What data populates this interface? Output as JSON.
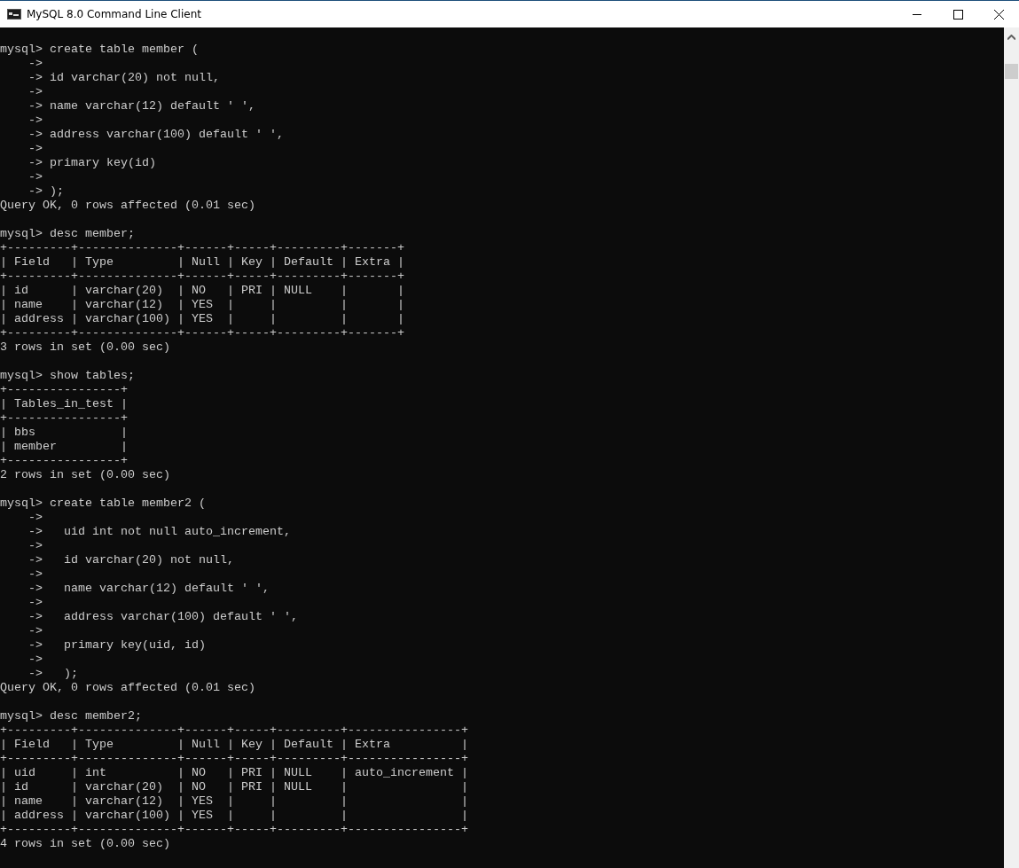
{
  "window": {
    "title": "MySQL 8.0 Command Line Client"
  },
  "console": {
    "blocks": [
      {
        "lines": [
          "mysql> create table member (",
          "    ->",
          "    -> id varchar(20) not null,",
          "    ->",
          "    -> name varchar(12) default ' ',",
          "    ->",
          "    -> address varchar(100) default ' ',",
          "    ->",
          "    -> primary key(id)",
          "    ->",
          "    -> );",
          "Query OK, 0 rows affected (0.01 sec)"
        ]
      },
      {
        "lines": [
          "mysql> desc member;",
          "+---------+--------------+------+-----+---------+-------+",
          "| Field   | Type         | Null | Key | Default | Extra |",
          "+---------+--------------+------+-----+---------+-------+",
          "| id      | varchar(20)  | NO   | PRI | NULL    |       |",
          "| name    | varchar(12)  | YES  |     |         |       |",
          "| address | varchar(100) | YES  |     |         |       |",
          "+---------+--------------+------+-----+---------+-------+",
          "3 rows in set (0.00 sec)"
        ]
      },
      {
        "lines": [
          "mysql> show tables;",
          "+----------------+",
          "| Tables_in_test |",
          "+----------------+",
          "| bbs            |",
          "| member         |",
          "+----------------+",
          "2 rows in set (0.00 sec)"
        ]
      },
      {
        "lines": [
          "mysql> create table member2 (",
          "    ->",
          "    ->   uid int not null auto_increment,",
          "    ->",
          "    ->   id varchar(20) not null,",
          "    ->",
          "    ->   name varchar(12) default ' ',",
          "    ->",
          "    ->   address varchar(100) default ' ',",
          "    ->",
          "    ->   primary key(uid, id)",
          "    ->",
          "    ->   );",
          "Query OK, 0 rows affected (0.01 sec)"
        ]
      },
      {
        "lines": [
          "mysql> desc member2;",
          "+---------+--------------+------+-----+---------+----------------+",
          "| Field   | Type         | Null | Key | Default | Extra          |",
          "+---------+--------------+------+-----+---------+----------------+",
          "| uid     | int          | NO   | PRI | NULL    | auto_increment |",
          "| id      | varchar(20)  | NO   | PRI | NULL    |                |",
          "| name    | varchar(12)  | YES  |     |         |                |",
          "| address | varchar(100) | YES  |     |         |                |",
          "+---------+--------------+------+-----+---------+----------------+",
          "4 rows in set (0.00 sec)"
        ]
      }
    ]
  }
}
